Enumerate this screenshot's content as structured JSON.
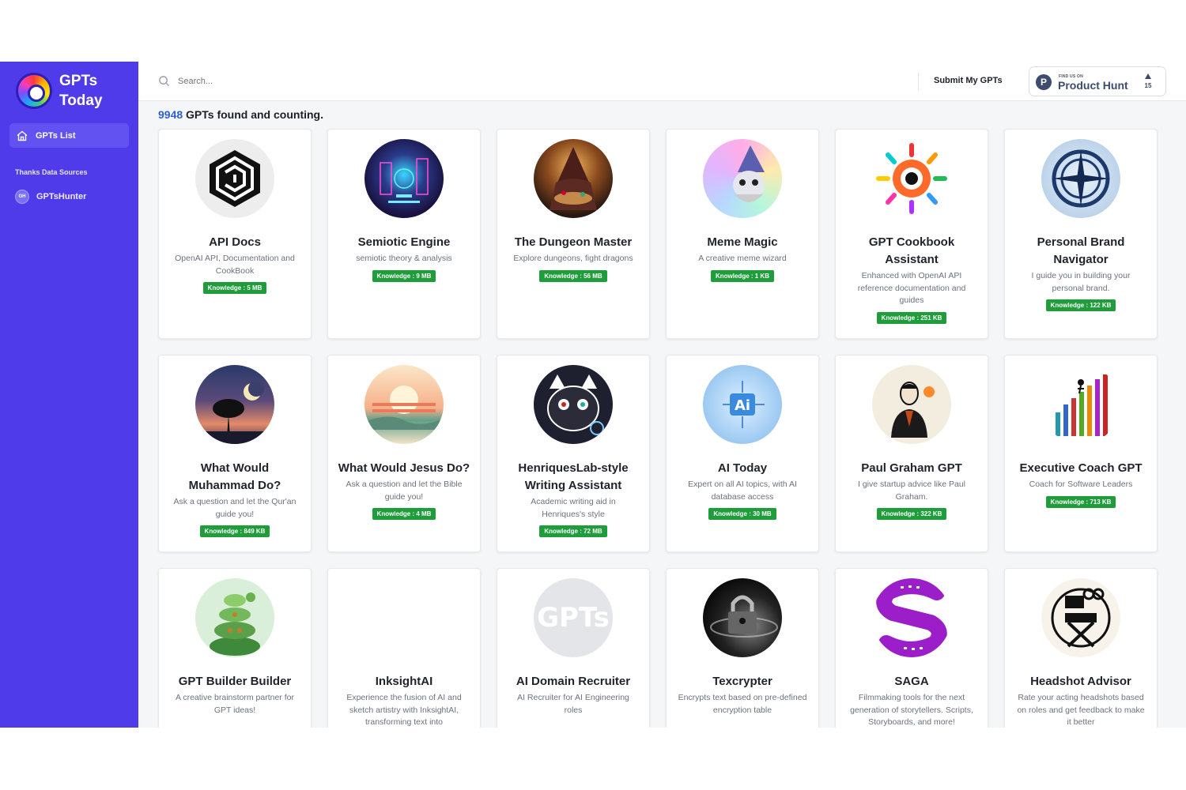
{
  "sidebar": {
    "brand_line1": "GPTs",
    "brand_line2": "Today",
    "nav_active": "GPTs List",
    "sources_title": "Thanks Data Sources",
    "source_badge": "GH",
    "source_label": "GPTsHunter",
    "accent": "#4f3bea"
  },
  "header": {
    "search_placeholder": "Search...",
    "submit_label": "Submit My GPTs",
    "ph_small": "FIND US ON",
    "ph_name": "Product Hunt",
    "ph_logo": "P",
    "ph_count": "15"
  },
  "summary": {
    "count": "9948",
    "text": " GPTs found and counting."
  },
  "cards": [
    {
      "title": "API Docs",
      "desc": "OpenAI API, Documentation and CookBook",
      "knowledge": "Knowledge : 5 MB",
      "icon": "maze-hexagon-icon"
    },
    {
      "title": "Semiotic Engine",
      "desc": "semiotic theory & analysis",
      "knowledge": "Knowledge : 9 MB",
      "icon": "neon-circuit-city-icon"
    },
    {
      "title": "The Dungeon Master",
      "desc": "Explore dungeons, fight dragons",
      "knowledge": "Knowledge : 56 MB",
      "icon": "hooded-wizard-icon"
    },
    {
      "title": "Meme Magic",
      "desc": "A creative meme wizard",
      "knowledge": "Knowledge : 1 KB",
      "icon": "wizard-cat-icon"
    },
    {
      "title": "GPT Cookbook Assistant",
      "desc": "Enhanced with OpenAI API reference documentation and guides",
      "knowledge": "Knowledge : 251 KB",
      "icon": "colorful-eye-burst-icon"
    },
    {
      "title": "Personal Brand Navigator",
      "desc": "I guide you in building your personal brand.",
      "knowledge": "Knowledge : 122 KB",
      "icon": "compass-rose-icon"
    },
    {
      "title": "What Would Muhammad Do?",
      "desc": "Ask a question and let the Qur'an guide you!",
      "knowledge": "Knowledge : 849 KB",
      "icon": "crescent-moon-tree-icon"
    },
    {
      "title": "What Would Jesus Do?",
      "desc": "Ask a question and let the Bible guide you!",
      "knowledge": "Knowledge : 4 MB",
      "icon": "sunset-hills-icon"
    },
    {
      "title": "HenriquesLab-style Writing Assistant",
      "desc": "Academic writing aid in Henriques's style",
      "knowledge": "Knowledge : 72 MB",
      "icon": "patterned-cat-icon"
    },
    {
      "title": "AI Today",
      "desc": "Expert on all AI topics, with AI database access",
      "knowledge": "Knowledge : 30 MB",
      "icon": "ai-circuit-icon"
    },
    {
      "title": "Paul Graham GPT",
      "desc": "I give startup advice like Paul Graham.",
      "knowledge": "Knowledge : 322 KB",
      "icon": "businessman-lightbulb-icon"
    },
    {
      "title": "Executive Coach GPT",
      "desc": "Coach for Software Leaders",
      "knowledge": "Knowledge : 713 KB",
      "icon": "climbing-bars-icon"
    },
    {
      "title": "GPT Builder Builder",
      "desc": "A creative brainstorm partner for GPT ideas!",
      "knowledge": "",
      "icon": "stacked-turtles-icon"
    },
    {
      "title": "InksightAI",
      "desc": "Experience the fusion of AI and sketch artistry with InksightAI, transforming text into",
      "knowledge": "",
      "icon": ""
    },
    {
      "title": "AI Domain Recruiter",
      "desc": "AI Recruiter for AI Engineering roles",
      "knowledge": "",
      "icon": "gpts-placeholder-icon",
      "placeholder_text": "GPTs"
    },
    {
      "title": "Texcrypter",
      "desc": "Encrypts text based on pre-defined encryption table",
      "knowledge": "",
      "icon": "padlock-galaxy-icon"
    },
    {
      "title": "SAGA",
      "desc": "Filmmaking tools for the next generation of storytellers. Scripts, Storyboards, and more!",
      "knowledge": "",
      "icon": "film-strip-s-icon"
    },
    {
      "title": "Headshot Advisor",
      "desc": "Rate your acting headshots based on roles and get feedback to make it better",
      "knowledge": "",
      "icon": "director-chair-camera-icon"
    }
  ]
}
